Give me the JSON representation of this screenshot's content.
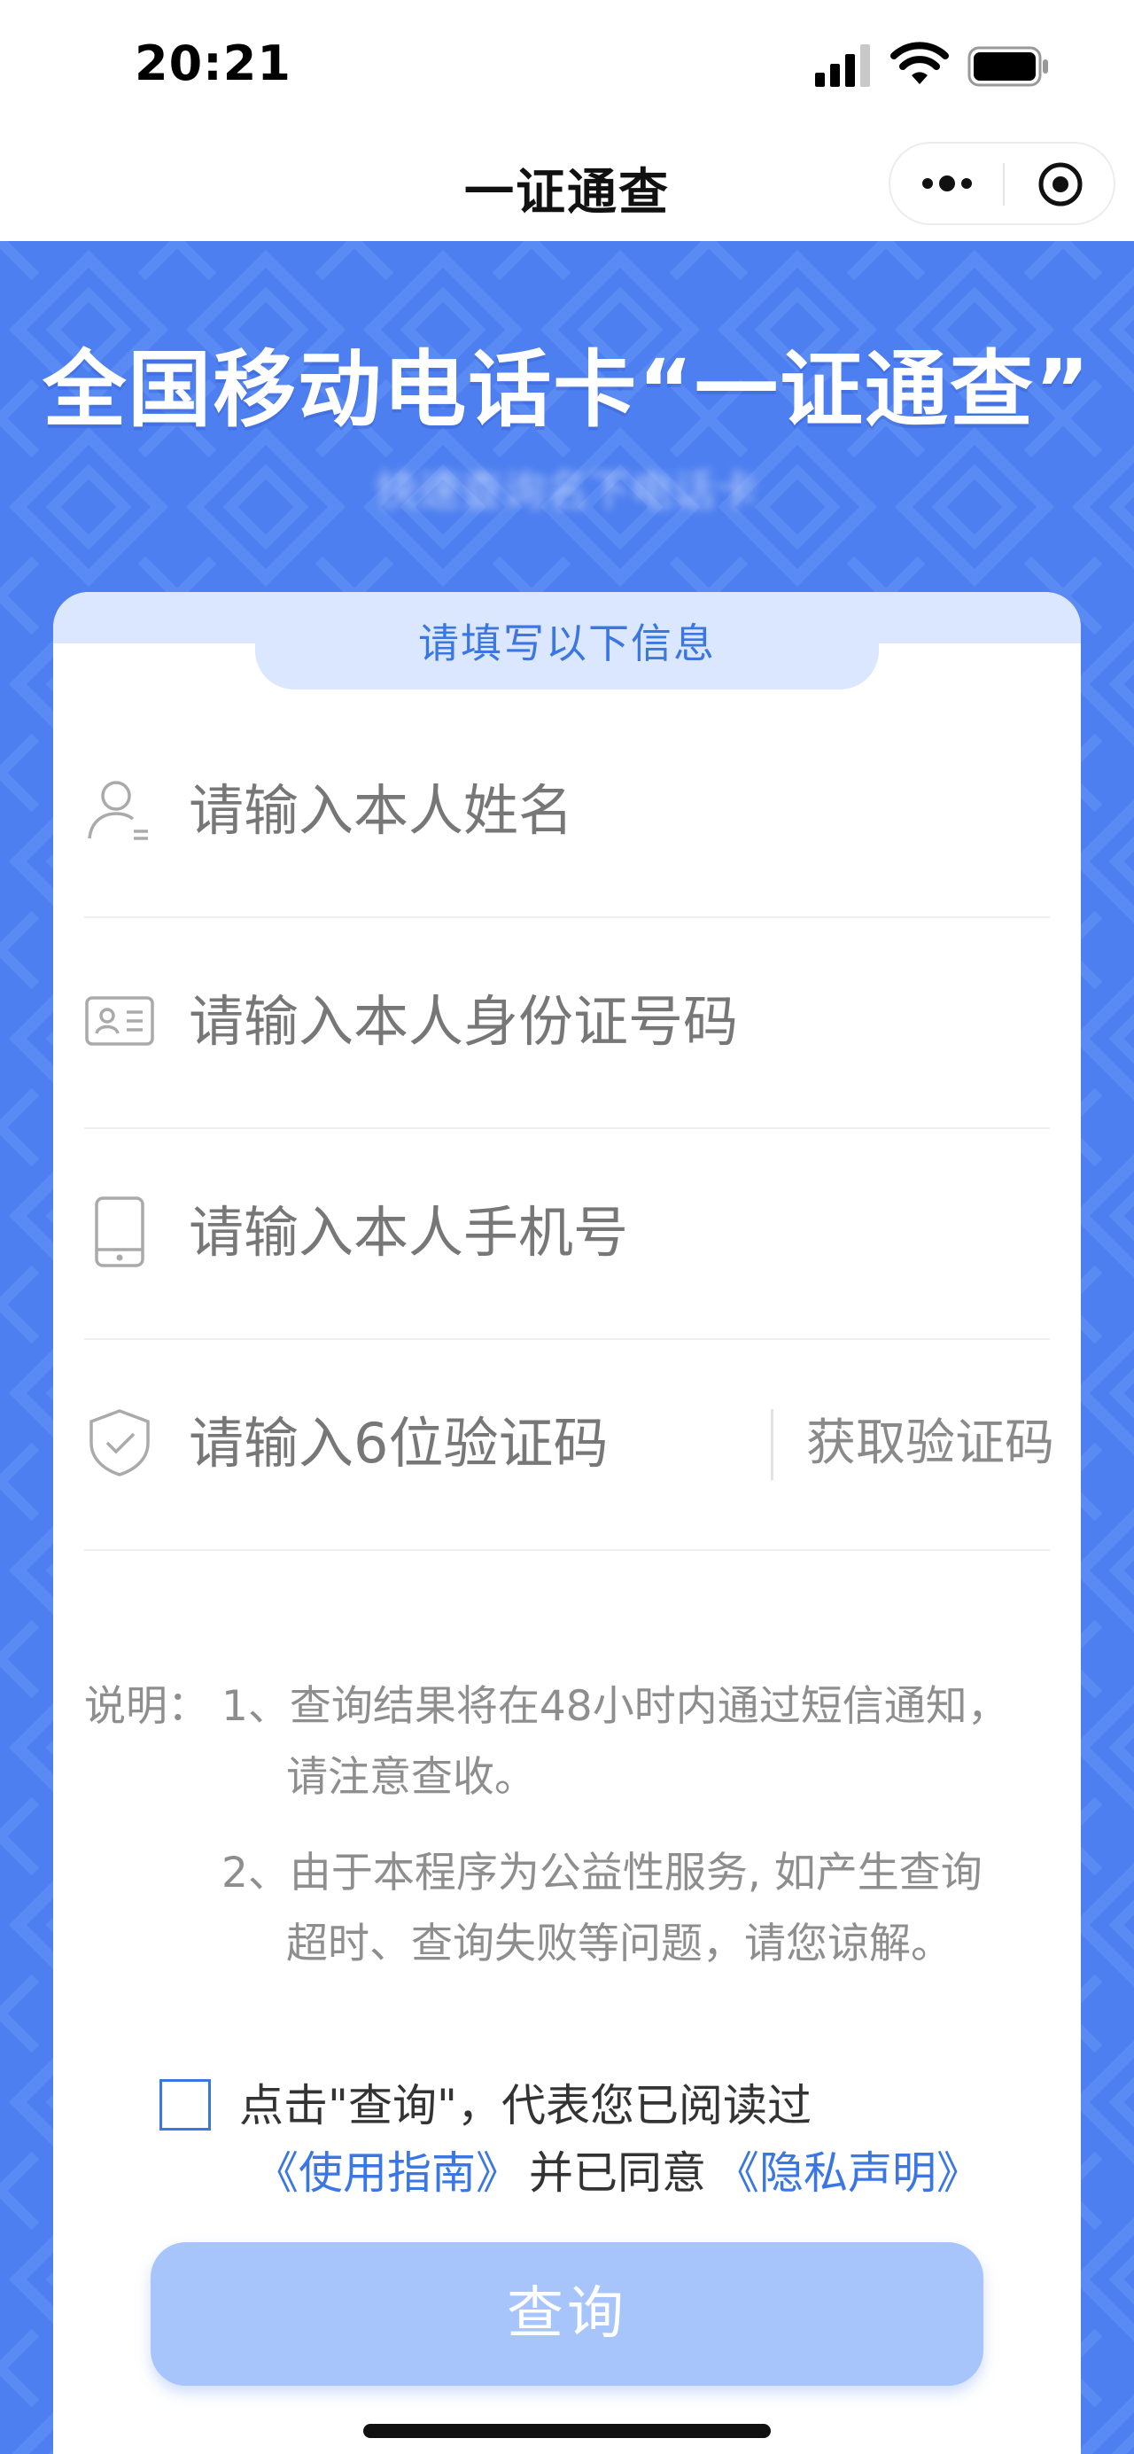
{
  "status_bar": {
    "time": "20:21"
  },
  "nav": {
    "title": "一证通查"
  },
  "banner": {
    "title": "全国移动电话卡“一证通查”",
    "subtitle": "快速查询名下电话卡"
  },
  "card": {
    "header": "请填写以下信息",
    "fields": {
      "name_placeholder": "请输入本人姓名",
      "id_placeholder": "请输入本人身份证号码",
      "phone_placeholder": "请输入本人手机号",
      "code_placeholder": "请输入6位验证码",
      "get_code_label": "获取验证码"
    },
    "notes": {
      "label": "说明：",
      "item1_line1": "1、查询结果将在48小时内通过短信通知，",
      "item1_line2": "请注意查收。",
      "item2_line1": "2、由于本程序为公益性服务, 如产生查询",
      "item2_line2": "超时、查询失败等问题，请您谅解。"
    },
    "agreement": {
      "line1": "点击\"查询\"，代表您已阅读过",
      "guide_link": "《使用指南》",
      "middle": "并已同意",
      "privacy_link": "《隐私声明》"
    },
    "query_button": "查询"
  },
  "colors": {
    "banner_blue": "#4d7ff0",
    "accent": "#3b77e3",
    "button_disabled": "#a7c4fb"
  },
  "icons": [
    "signal-icon",
    "wifi-icon",
    "battery-icon",
    "more-icon",
    "target-icon",
    "user-icon",
    "id-card-icon",
    "phone-icon",
    "shield-icon"
  ]
}
